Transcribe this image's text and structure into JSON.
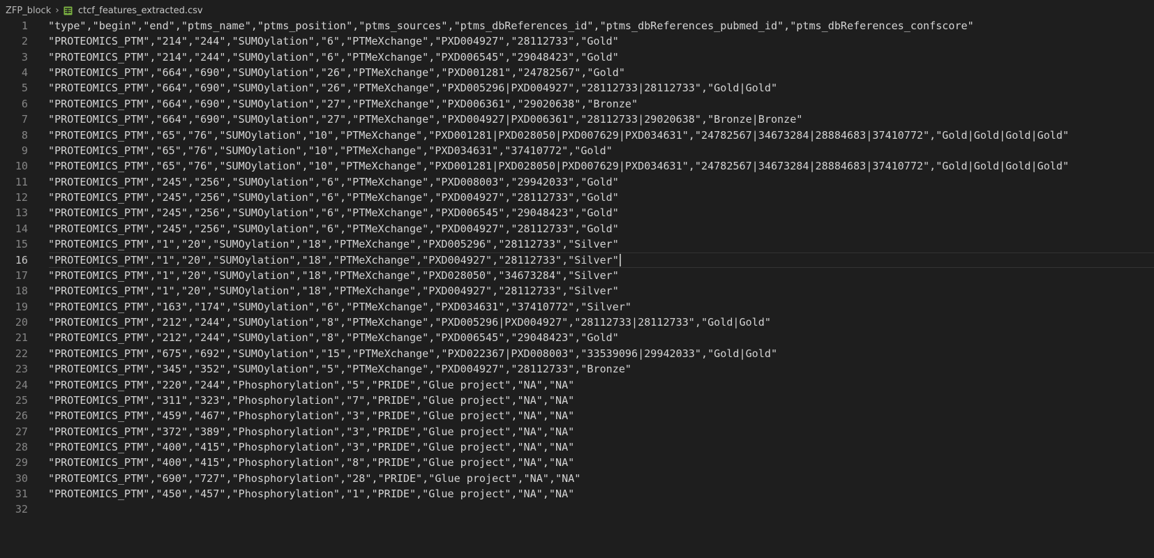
{
  "breadcrumb": {
    "folder": "ZFP_block",
    "separator": "›",
    "file_icon": "table-file-icon",
    "file_name": "ctcf_features_extracted.csv"
  },
  "colors": {
    "background": "#1e1e1e",
    "text": "#d4d4d4",
    "line_number": "#858585",
    "active_line_number": "#c6c6c6",
    "file_icon_green": "#7cb342"
  },
  "editor": {
    "current_line": 16,
    "lines": [
      {
        "n": "1",
        "text": "\"type\",\"begin\",\"end\",\"ptms_name\",\"ptms_position\",\"ptms_sources\",\"ptms_dbReferences_id\",\"ptms_dbReferences_pubmed_id\",\"ptms_dbReferences_confscore\""
      },
      {
        "n": "2",
        "text": "\"PROTEOMICS_PTM\",\"214\",\"244\",\"SUMOylation\",\"6\",\"PTMeXchange\",\"PXD004927\",\"28112733\",\"Gold\""
      },
      {
        "n": "3",
        "text": "\"PROTEOMICS_PTM\",\"214\",\"244\",\"SUMOylation\",\"6\",\"PTMeXchange\",\"PXD006545\",\"29048423\",\"Gold\""
      },
      {
        "n": "4",
        "text": "\"PROTEOMICS_PTM\",\"664\",\"690\",\"SUMOylation\",\"26\",\"PTMeXchange\",\"PXD001281\",\"24782567\",\"Gold\""
      },
      {
        "n": "5",
        "text": "\"PROTEOMICS_PTM\",\"664\",\"690\",\"SUMOylation\",\"26\",\"PTMeXchange\",\"PXD005296|PXD004927\",\"28112733|28112733\",\"Gold|Gold\""
      },
      {
        "n": "6",
        "text": "\"PROTEOMICS_PTM\",\"664\",\"690\",\"SUMOylation\",\"27\",\"PTMeXchange\",\"PXD006361\",\"29020638\",\"Bronze\""
      },
      {
        "n": "7",
        "text": "\"PROTEOMICS_PTM\",\"664\",\"690\",\"SUMOylation\",\"27\",\"PTMeXchange\",\"PXD004927|PXD006361\",\"28112733|29020638\",\"Bronze|Bronze\""
      },
      {
        "n": "8",
        "text": "\"PROTEOMICS_PTM\",\"65\",\"76\",\"SUMOylation\",\"10\",\"PTMeXchange\",\"PXD001281|PXD028050|PXD007629|PXD034631\",\"24782567|34673284|28884683|37410772\",\"Gold|Gold|Gold|Gold\""
      },
      {
        "n": "9",
        "text": "\"PROTEOMICS_PTM\",\"65\",\"76\",\"SUMOylation\",\"10\",\"PTMeXchange\",\"PXD034631\",\"37410772\",\"Gold\""
      },
      {
        "n": "10",
        "text": "\"PROTEOMICS_PTM\",\"65\",\"76\",\"SUMOylation\",\"10\",\"PTMeXchange\",\"PXD001281|PXD028050|PXD007629|PXD034631\",\"24782567|34673284|28884683|37410772\",\"Gold|Gold|Gold|Gold\""
      },
      {
        "n": "11",
        "text": "\"PROTEOMICS_PTM\",\"245\",\"256\",\"SUMOylation\",\"6\",\"PTMeXchange\",\"PXD008003\",\"29942033\",\"Gold\""
      },
      {
        "n": "12",
        "text": "\"PROTEOMICS_PTM\",\"245\",\"256\",\"SUMOylation\",\"6\",\"PTMeXchange\",\"PXD004927\",\"28112733\",\"Gold\""
      },
      {
        "n": "13",
        "text": "\"PROTEOMICS_PTM\",\"245\",\"256\",\"SUMOylation\",\"6\",\"PTMeXchange\",\"PXD006545\",\"29048423\",\"Gold\""
      },
      {
        "n": "14",
        "text": "\"PROTEOMICS_PTM\",\"245\",\"256\",\"SUMOylation\",\"6\",\"PTMeXchange\",\"PXD004927\",\"28112733\",\"Gold\""
      },
      {
        "n": "15",
        "text": "\"PROTEOMICS_PTM\",\"1\",\"20\",\"SUMOylation\",\"18\",\"PTMeXchange\",\"PXD005296\",\"28112733\",\"Silver\""
      },
      {
        "n": "16",
        "text": "\"PROTEOMICS_PTM\",\"1\",\"20\",\"SUMOylation\",\"18\",\"PTMeXchange\",\"PXD004927\",\"28112733\",\"Silver\""
      },
      {
        "n": "17",
        "text": "\"PROTEOMICS_PTM\",\"1\",\"20\",\"SUMOylation\",\"18\",\"PTMeXchange\",\"PXD028050\",\"34673284\",\"Silver\""
      },
      {
        "n": "18",
        "text": "\"PROTEOMICS_PTM\",\"1\",\"20\",\"SUMOylation\",\"18\",\"PTMeXchange\",\"PXD004927\",\"28112733\",\"Silver\""
      },
      {
        "n": "19",
        "text": "\"PROTEOMICS_PTM\",\"163\",\"174\",\"SUMOylation\",\"6\",\"PTMeXchange\",\"PXD034631\",\"37410772\",\"Silver\""
      },
      {
        "n": "20",
        "text": "\"PROTEOMICS_PTM\",\"212\",\"244\",\"SUMOylation\",\"8\",\"PTMeXchange\",\"PXD005296|PXD004927\",\"28112733|28112733\",\"Gold|Gold\""
      },
      {
        "n": "21",
        "text": "\"PROTEOMICS_PTM\",\"212\",\"244\",\"SUMOylation\",\"8\",\"PTMeXchange\",\"PXD006545\",\"29048423\",\"Gold\""
      },
      {
        "n": "22",
        "text": "\"PROTEOMICS_PTM\",\"675\",\"692\",\"SUMOylation\",\"15\",\"PTMeXchange\",\"PXD022367|PXD008003\",\"33539096|29942033\",\"Gold|Gold\""
      },
      {
        "n": "23",
        "text": "\"PROTEOMICS_PTM\",\"345\",\"352\",\"SUMOylation\",\"5\",\"PTMeXchange\",\"PXD004927\",\"28112733\",\"Bronze\""
      },
      {
        "n": "24",
        "text": "\"PROTEOMICS_PTM\",\"220\",\"244\",\"Phosphorylation\",\"5\",\"PRIDE\",\"Glue project\",\"NA\",\"NA\""
      },
      {
        "n": "25",
        "text": "\"PROTEOMICS_PTM\",\"311\",\"323\",\"Phosphorylation\",\"7\",\"PRIDE\",\"Glue project\",\"NA\",\"NA\""
      },
      {
        "n": "26",
        "text": "\"PROTEOMICS_PTM\",\"459\",\"467\",\"Phosphorylation\",\"3\",\"PRIDE\",\"Glue project\",\"NA\",\"NA\""
      },
      {
        "n": "27",
        "text": "\"PROTEOMICS_PTM\",\"372\",\"389\",\"Phosphorylation\",\"3\",\"PRIDE\",\"Glue project\",\"NA\",\"NA\""
      },
      {
        "n": "28",
        "text": "\"PROTEOMICS_PTM\",\"400\",\"415\",\"Phosphorylation\",\"3\",\"PRIDE\",\"Glue project\",\"NA\",\"NA\""
      },
      {
        "n": "29",
        "text": "\"PROTEOMICS_PTM\",\"400\",\"415\",\"Phosphorylation\",\"8\",\"PRIDE\",\"Glue project\",\"NA\",\"NA\""
      },
      {
        "n": "30",
        "text": "\"PROTEOMICS_PTM\",\"690\",\"727\",\"Phosphorylation\",\"28\",\"PRIDE\",\"Glue project\",\"NA\",\"NA\""
      },
      {
        "n": "31",
        "text": "\"PROTEOMICS_PTM\",\"450\",\"457\",\"Phosphorylation\",\"1\",\"PRIDE\",\"Glue project\",\"NA\",\"NA\""
      },
      {
        "n": "32",
        "text": ""
      }
    ]
  }
}
